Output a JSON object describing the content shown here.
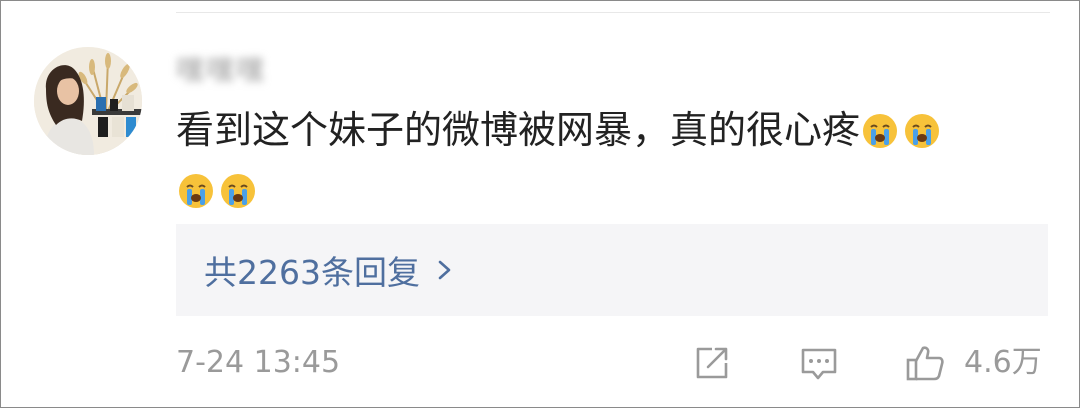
{
  "comment": {
    "username": "嘿嘿嘿",
    "text": "看到这个妹子的微博被网暴，真的很心疼",
    "emojis_inline": [
      "crying-face",
      "crying-face"
    ],
    "emojis_next_line": [
      "crying-face",
      "crying-face"
    ]
  },
  "replies": {
    "label": "共2263条回复"
  },
  "meta": {
    "timestamp": "7-24 13:45",
    "like_count": "4.6万"
  },
  "icons": {
    "share": "share-icon",
    "comment": "comment-icon",
    "like": "thumbs-up-icon",
    "chevron": "chevron-right-icon"
  },
  "colors": {
    "reply_link": "#4f6f9f",
    "meta_gray": "#9a9a9a",
    "reply_bg": "#f5f5f7",
    "emoji_yellow": "#f7c23a",
    "tear_blue": "#4aa0e8"
  }
}
